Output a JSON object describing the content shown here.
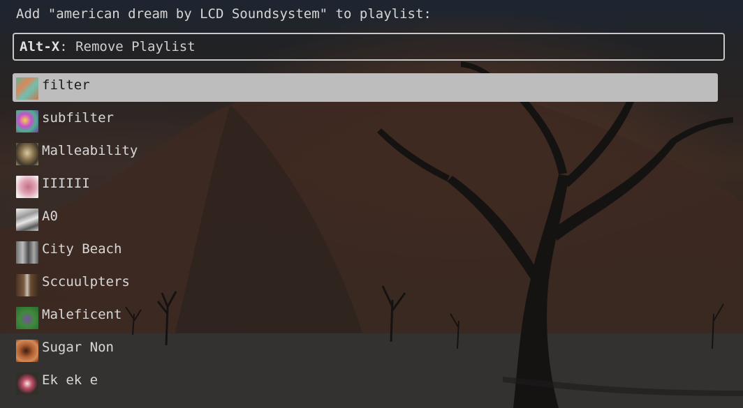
{
  "prompt": {
    "text": "Add \"american dream by LCD Soundsystem\" to playlist:"
  },
  "input": {
    "key": "Alt-X",
    "hint": ": Remove Playlist"
  },
  "playlists": [
    {
      "label": "filter",
      "selected": true,
      "art": "filter-cover"
    },
    {
      "label": "subfilter",
      "selected": false,
      "art": "subfilter-cover"
    },
    {
      "label": "Malleability",
      "selected": false,
      "art": "malleability-cover"
    },
    {
      "label": "IIIIII",
      "selected": false,
      "art": "iiiiii-cover"
    },
    {
      "label": "A0",
      "selected": false,
      "art": "a0-cover"
    },
    {
      "label": "City Beach",
      "selected": false,
      "art": "city-beach-cover"
    },
    {
      "label": "Sccuulpters",
      "selected": false,
      "art": "sccuulpters-cover"
    },
    {
      "label": "Maleficent",
      "selected": false,
      "art": "maleficent-cover"
    },
    {
      "label": "Sugar Non",
      "selected": false,
      "art": "sugar-non-cover"
    },
    {
      "label": "Ek ek e",
      "selected": false,
      "art": "ek-ek-e-cover"
    }
  ],
  "colors": {
    "selection": "#bdbdbd",
    "text": "#d8d8d8",
    "selected_text": "#1a1a1a",
    "border": "#c8c8c8"
  }
}
